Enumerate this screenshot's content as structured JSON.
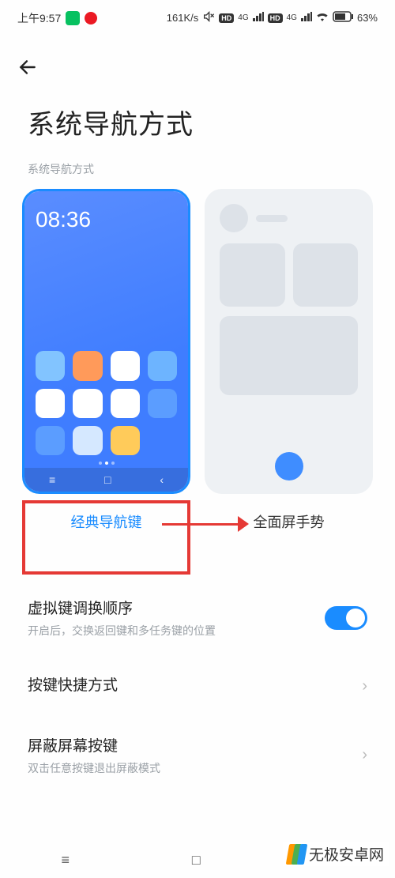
{
  "status_bar": {
    "time": "上午9:57",
    "netspeed": "161K/s",
    "sim1_label": "4G",
    "sim2_label": "4G",
    "hd": "HD",
    "battery_pct": "63%"
  },
  "page": {
    "title": "系统导航方式",
    "section_label": "系统导航方式"
  },
  "options": {
    "classic": {
      "label": "经典导航键",
      "selected": true,
      "preview_time": "08:36",
      "nav_icons": {
        "menu": "≡",
        "home": "□",
        "back": "‹"
      }
    },
    "gesture": {
      "label": "全面屏手势",
      "selected": false
    }
  },
  "settings": {
    "swap_order": {
      "title": "虚拟键调换顺序",
      "sub": "开启后，交换返回键和多任务键的位置",
      "on": true
    },
    "shortcut": {
      "title": "按键快捷方式"
    },
    "hide_keys": {
      "title": "屏蔽屏幕按键",
      "sub": "双击任意按键退出屏蔽模式"
    }
  },
  "sys_nav": {
    "menu": "≡",
    "home": "□",
    "back": "◁"
  },
  "watermark": "无极安卓网"
}
